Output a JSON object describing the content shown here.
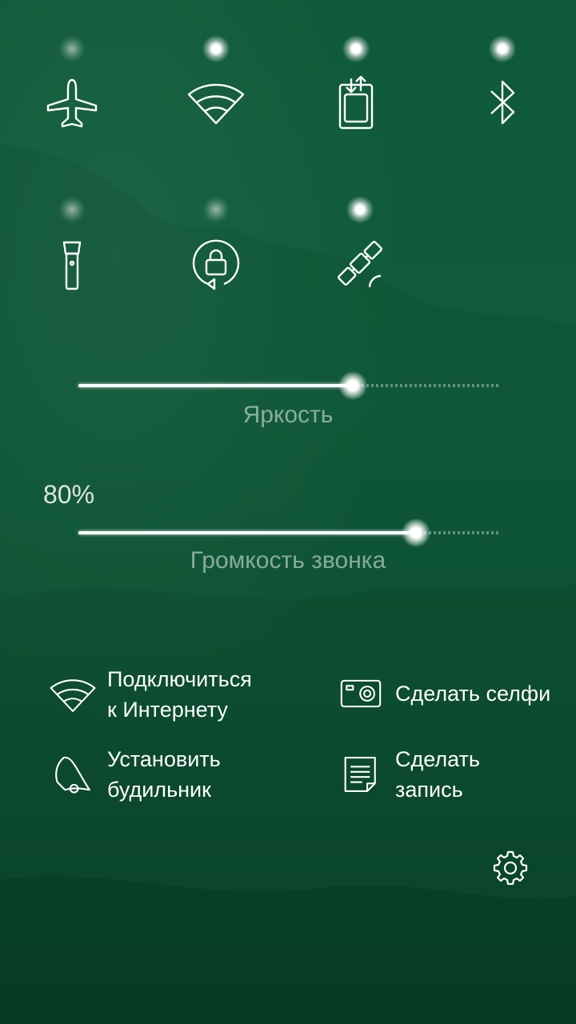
{
  "toggles": [
    {
      "icon": "airplane-icon",
      "active": false
    },
    {
      "icon": "wifi-icon",
      "active": true
    },
    {
      "icon": "mobile-data-icon",
      "active": true
    },
    {
      "icon": "bluetooth-icon",
      "active": true
    },
    {
      "icon": "flashlight-icon",
      "active": false
    },
    {
      "icon": "orientation-lock-icon",
      "active": false
    },
    {
      "icon": "gps-satellite-icon",
      "active": true
    }
  ],
  "brightness": {
    "label": "Яркость",
    "level": 0.65
  },
  "ringtone_volume": {
    "label": "Громкость звонка",
    "value_text": "80%",
    "level": 0.8
  },
  "shortcuts": {
    "connect": {
      "line1": "Подключиться",
      "line2": "к Интернету",
      "icon": "wifi-icon"
    },
    "selfie": {
      "line1": "Сделать селфи",
      "icon": "camera-icon"
    },
    "alarm": {
      "line1": "Установить",
      "line2": "будильник",
      "icon": "alarm-bell-icon"
    },
    "note": {
      "line1": "Сделать",
      "line2": "запись",
      "icon": "note-icon"
    }
  },
  "settings_icon": "gear-icon",
  "colors": {
    "background": "#105c3c",
    "foreground": "#ffffff"
  }
}
